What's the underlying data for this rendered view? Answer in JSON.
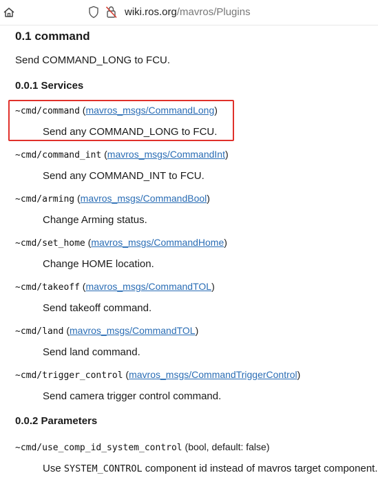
{
  "browser": {
    "url_host": "wiki.ros.org",
    "url_path": "/mavros/Plugins"
  },
  "page": {
    "section_title": "0.1 command",
    "section_desc": "Send COMMAND_LONG to FCU.",
    "services_heading": "0.0.1 Services",
    "parameters_heading": "0.0.2 Parameters",
    "services": [
      {
        "name": "~cmd/command",
        "type": "mavros_msgs/CommandLong",
        "desc": "Send any COMMAND_LONG to FCU."
      },
      {
        "name": "~cmd/command_int",
        "type": "mavros_msgs/CommandInt",
        "desc": "Send any COMMAND_INT to FCU."
      },
      {
        "name": "~cmd/arming",
        "type": "mavros_msgs/CommandBool",
        "desc": "Change Arming status."
      },
      {
        "name": "~cmd/set_home",
        "type": "mavros_msgs/CommandHome",
        "desc": "Change HOME location."
      },
      {
        "name": "~cmd/takeoff",
        "type": "mavros_msgs/CommandTOL",
        "desc": "Send takeoff command."
      },
      {
        "name": "~cmd/land",
        "type": "mavros_msgs/CommandTOL",
        "desc": "Send land command."
      },
      {
        "name": "~cmd/trigger_control",
        "type": "mavros_msgs/CommandTriggerControl",
        "desc": "Send camera trigger control command."
      }
    ],
    "parameter": {
      "name": "~cmd/use_comp_id_system_control",
      "meta": "(bool, default: false)",
      "desc_pre": "Use ",
      "desc_code": "SYSTEM_CONTROL",
      "desc_post": " component id instead of mavros target component."
    }
  },
  "colors": {
    "link": "#2a6db5",
    "highlight": "#e0302a"
  }
}
